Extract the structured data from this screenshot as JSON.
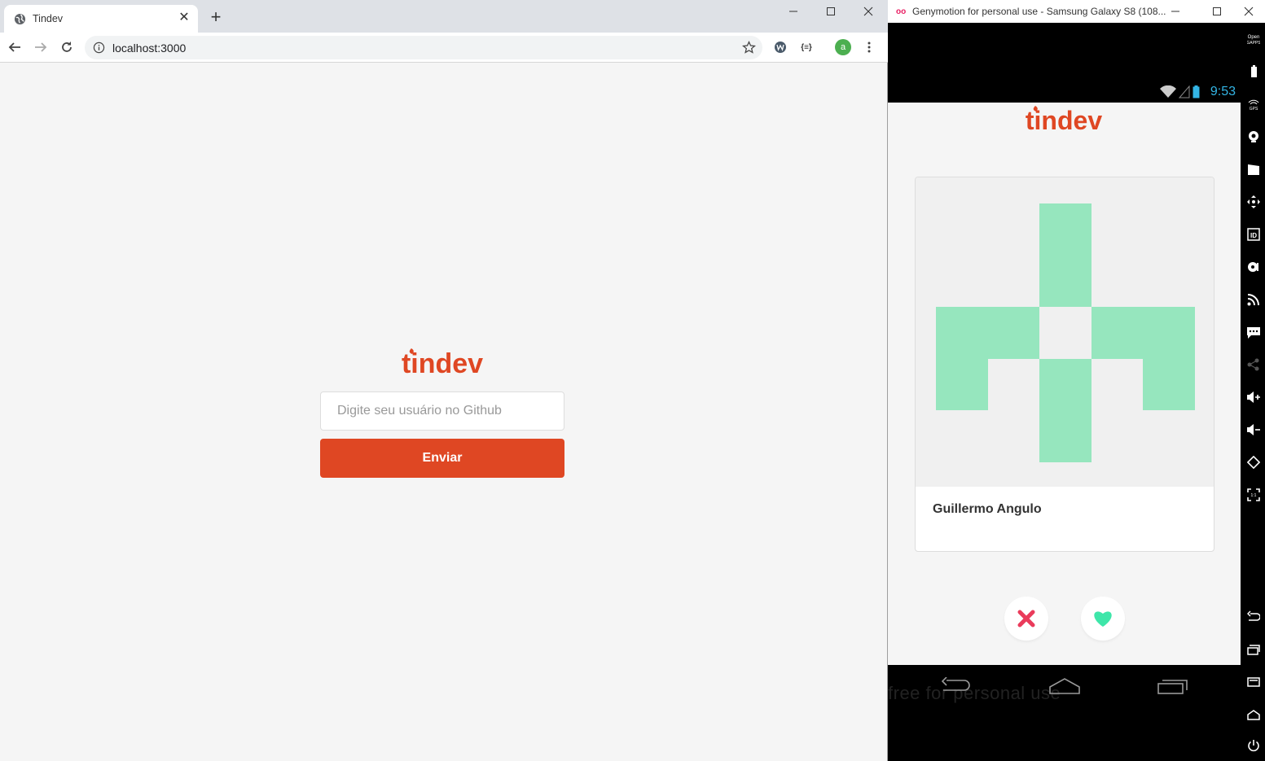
{
  "browser": {
    "tab_title": "Tindev",
    "tab_close": "✕",
    "new_tab": "+",
    "url": "localhost:3000",
    "avatar_letter": "a",
    "extension_label": "{≡}"
  },
  "web_app": {
    "logo_text": "tindev",
    "input_placeholder": "Digite seu usuário no Github",
    "submit_label": "Enviar",
    "brand_color": "#df4723"
  },
  "emulator": {
    "title": "Genymotion for personal use - Samsung Galaxy S8 (108...",
    "logo": "oo",
    "clock": "9:53",
    "watermark": "free for personal use"
  },
  "mobile_app": {
    "logo_text": "tindev",
    "profile_name": "Guillermo Angulo",
    "dislike_color": "#ea3b5b",
    "like_color": "#3ee6a9",
    "identicon_color": "#96e6be"
  }
}
